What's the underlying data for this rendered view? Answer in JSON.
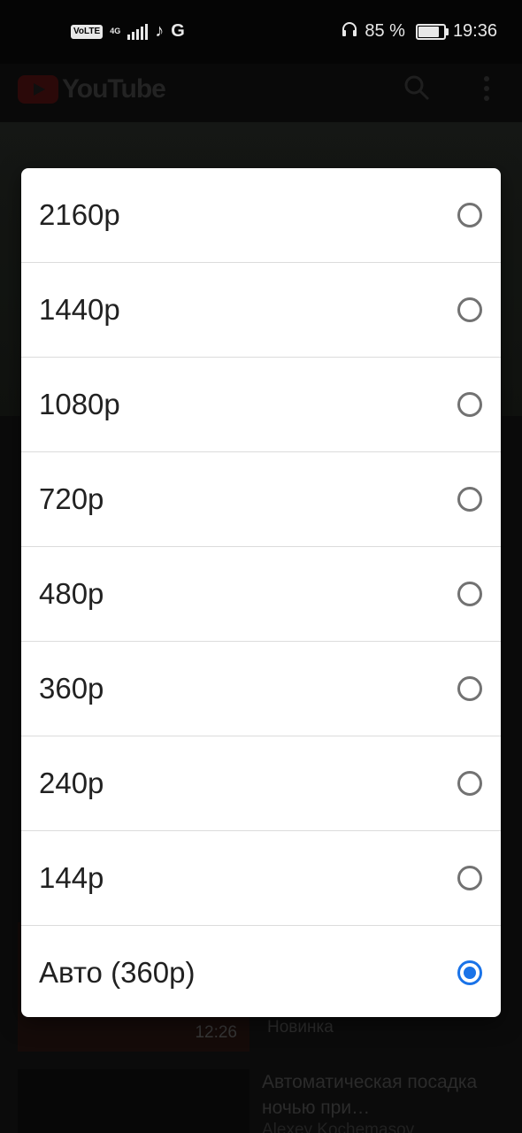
{
  "status_bar": {
    "volte": "VoLTE",
    "network": "4G",
    "battery_percent": "85 %",
    "battery_level": 0.85,
    "time": "19:36",
    "icons": [
      "volte-icon",
      "signal-icon",
      "tiktok-icon",
      "google-icon",
      "headset-icon",
      "battery-icon"
    ]
  },
  "app": {
    "logo_text": "YouTube",
    "recommendations": [
      {
        "duration": "12:26",
        "meta": "Новинка"
      },
      {
        "title": "Автоматическая посадка ночью при…",
        "channel": "Alexey Kochemasov"
      }
    ]
  },
  "quality_dialog": {
    "options": [
      {
        "label": "2160p",
        "selected": false
      },
      {
        "label": "1440p",
        "selected": false
      },
      {
        "label": "1080p",
        "selected": false
      },
      {
        "label": "720p",
        "selected": false
      },
      {
        "label": "480p",
        "selected": false
      },
      {
        "label": "360p",
        "selected": false
      },
      {
        "label": "240p",
        "selected": false
      },
      {
        "label": "144p",
        "selected": false
      },
      {
        "label": "Авто (360p)",
        "selected": true
      }
    ]
  },
  "colors": {
    "accent": "#1a73e8",
    "radio_unchecked": "#727272",
    "dialog_bg": "#ffffff",
    "text_primary": "#212121"
  }
}
